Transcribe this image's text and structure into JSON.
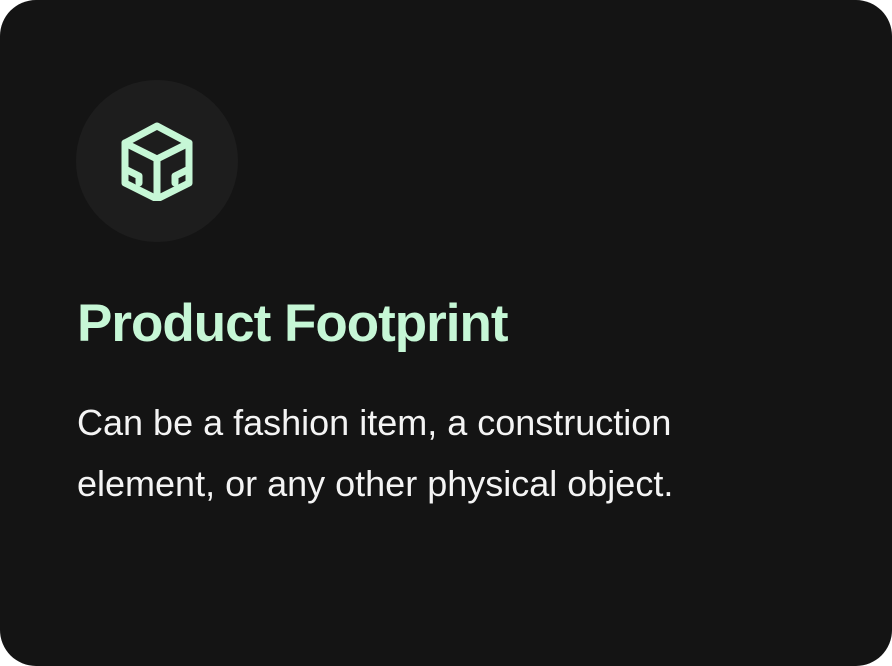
{
  "card": {
    "icon": "cube-icon",
    "title": "Product Footprint",
    "description": "Can be a fashion item, a construction element, or any other physical object."
  },
  "colors": {
    "card_background": "#141414",
    "icon_circle_background": "#1d1d1d",
    "accent": "#c6f7d6",
    "text": "#f4f4f4"
  }
}
